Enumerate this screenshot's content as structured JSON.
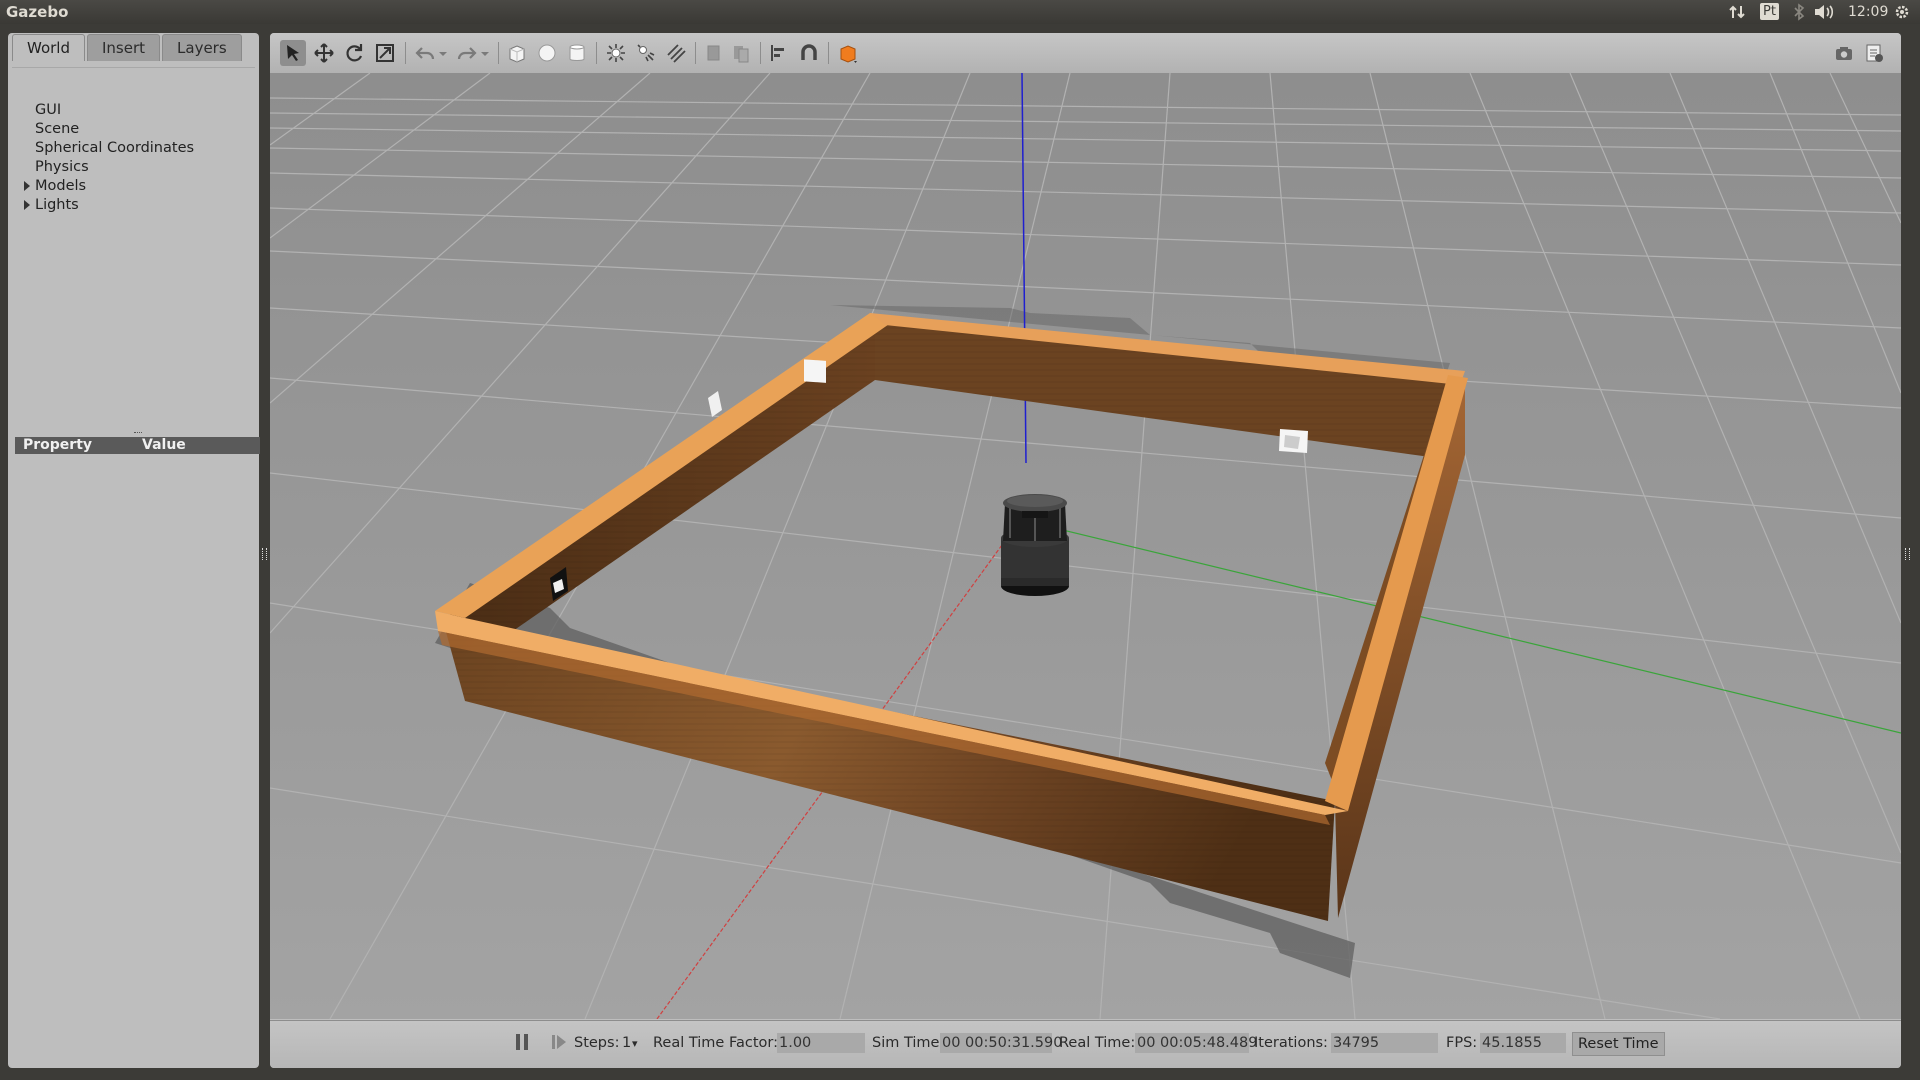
{
  "app": {
    "title": "Gazebo"
  },
  "indicators": {
    "keyboard": "Pt",
    "time": "12:09"
  },
  "tabs": [
    "World",
    "Insert",
    "Layers"
  ],
  "tree": [
    "GUI",
    "Scene",
    "Spherical Coordinates",
    "Physics",
    "Models",
    "Lights"
  ],
  "properties": {
    "col_property": "Property",
    "col_value": "Value"
  },
  "toolbar": {
    "icons": [
      "select-arrow-icon",
      "translate-icon",
      "rotate-icon",
      "scale-icon",
      "undo-icon",
      "undo-history-icon",
      "redo-icon",
      "redo-history-icon",
      "box-icon",
      "sphere-icon",
      "cylinder-icon",
      "point-light-icon",
      "spot-light-icon",
      "directional-light-icon",
      "copy-icon",
      "paste-icon",
      "align-icon",
      "snap-icon",
      "view-angle-icon",
      "screenshot-icon",
      "log-icon"
    ]
  },
  "bottombar": {
    "steps_label": "Steps:",
    "steps_value": "1",
    "rtf_label": "Real Time Factor:",
    "rtf_value": "1.00",
    "sim_time_label": "Sim Time:",
    "sim_time_value": "00 00:50:31.590",
    "real_time_label": "Real Time:",
    "real_time_value": "00 00:05:48.489",
    "iterations_label": "Iterations:",
    "iterations_value": "34795",
    "fps_label": "FPS:",
    "fps_value": "45.1855",
    "reset_label": "Reset Time"
  },
  "colors": {
    "ground": "#9c9c9c",
    "wall_wood": "#7a4a22",
    "wall_top": "#e59a4e",
    "axis_z": "#1f1fd0",
    "axis_x": "#d04040",
    "axis_y": "#3aa53a",
    "accent_orange": "#f07c1e"
  }
}
